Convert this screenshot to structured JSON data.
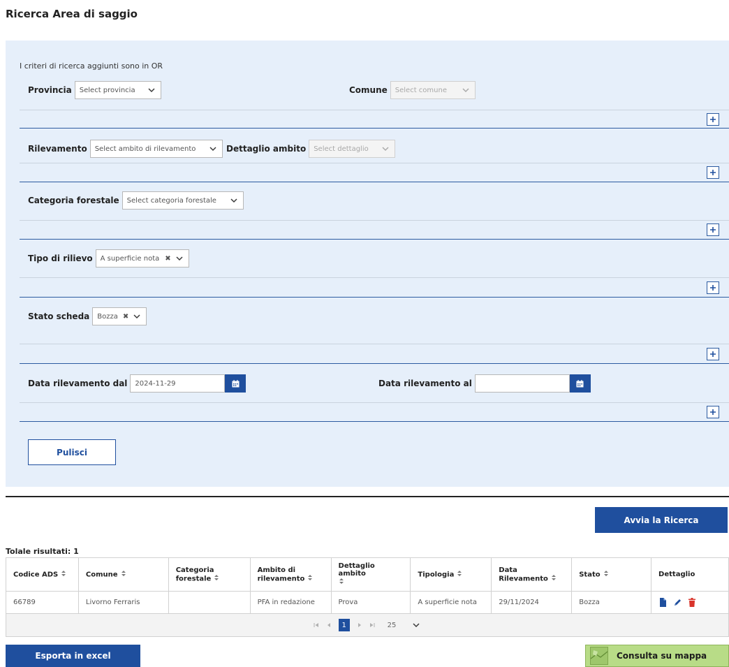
{
  "page": {
    "title": "Ricerca Area di saggio"
  },
  "filters": {
    "note": "I criteri di ricerca aggiunti sono in OR",
    "provincia": {
      "label": "Provincia",
      "placeholder": "Select provincia"
    },
    "comune": {
      "label": "Comune",
      "placeholder": "Select comune"
    },
    "rilevamento": {
      "label": "Rilevamento",
      "placeholder": "Select ambito di rilevamento"
    },
    "dettaglio_ambito": {
      "label": "Dettaglio ambito",
      "placeholder": "Select dettaglio"
    },
    "categoria_forestale": {
      "label": "Categoria forestale",
      "placeholder": "Select categoria forestale"
    },
    "tipo_rilievo": {
      "label": "Tipo di rilievo",
      "value": "A superficie nota"
    },
    "stato_scheda": {
      "label": "Stato scheda",
      "value": "Bozza"
    },
    "data_dal": {
      "label": "Data rilevamento dal",
      "value": "2024-11-29"
    },
    "data_al": {
      "label": "Data rilevamento al",
      "value": ""
    },
    "clear_label": "Pulisci"
  },
  "actions": {
    "search_label": "Avvia la Ricerca",
    "export_label": "Esporta in excel",
    "map_label": "Consulta su mappa"
  },
  "results": {
    "total_label": "Tolale risultati: 1",
    "columns": [
      "Codice ADS",
      "Comune",
      "Categoria forestale",
      "Ambito di rilevamento",
      "Dettaglio ambito",
      "Tipologia",
      "Data Rilevamento",
      "Stato",
      "Dettaglio"
    ],
    "rows": [
      {
        "codice": "66789",
        "comune": "Livorno Ferraris",
        "categoria": "",
        "ambito": "PFA in redazione",
        "dettaglio": "Prova",
        "tipologia": "A superficie nota",
        "data": "29/11/2024",
        "stato": "Bozza"
      }
    ],
    "pager": {
      "current_page": "1",
      "page_size": "25"
    }
  },
  "colors": {
    "primary": "#1f4f9e",
    "panel": "#e6effa",
    "delete": "#d9342b",
    "map": "#b8dc87"
  },
  "icons": [
    "chevron-down-icon",
    "clear-icon",
    "plus-icon",
    "calendar-icon",
    "sort-icon",
    "document-icon",
    "pencil-icon",
    "trash-icon",
    "map-thumbnail-icon"
  ]
}
